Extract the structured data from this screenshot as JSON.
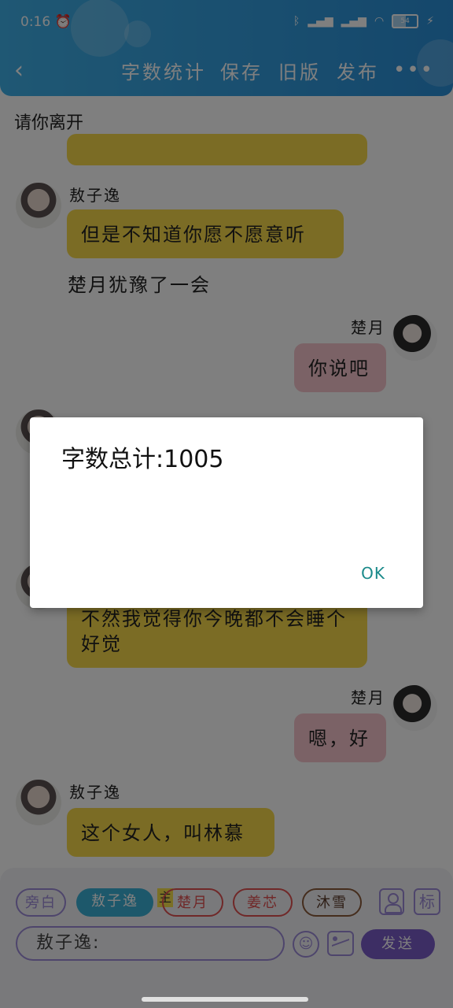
{
  "status_bar": {
    "time": "0:16",
    "battery": "54"
  },
  "header": {
    "word_count": "字数统计",
    "save": "保存",
    "old_version": "旧版",
    "publish": "发布",
    "more": "•••"
  },
  "chat": {
    "title_line": "请你离开",
    "messages": [
      {
        "speaker": "敖子逸",
        "text": "但是不知道你愿不愿意听"
      },
      {
        "narration": "楚月犹豫了一会"
      },
      {
        "speaker": "楚月",
        "text": "你说吧"
      },
      {
        "speaker": "敖子逸",
        "text": "不然我觉得你今晚都不会睡个好觉"
      },
      {
        "speaker": "楚月",
        "text": "嗯，好"
      },
      {
        "speaker": "敖子逸",
        "text": "这个女人，叫林慕"
      }
    ]
  },
  "composer": {
    "roles": [
      "旁白",
      "敖子逸",
      "楚月",
      "姜芯",
      "沐雪"
    ],
    "main_tag": "主",
    "input_value": "敖子逸:",
    "send_label": "发送",
    "tag_label": "标"
  },
  "dialog": {
    "text": "字数总计:1005",
    "ok_label": "OK"
  },
  "colors": {
    "header": "#2a8fd8",
    "yellow_bubble": "#f7d94a",
    "pink_bubble": "#f6c5cc",
    "send": "#7b5cc9"
  }
}
